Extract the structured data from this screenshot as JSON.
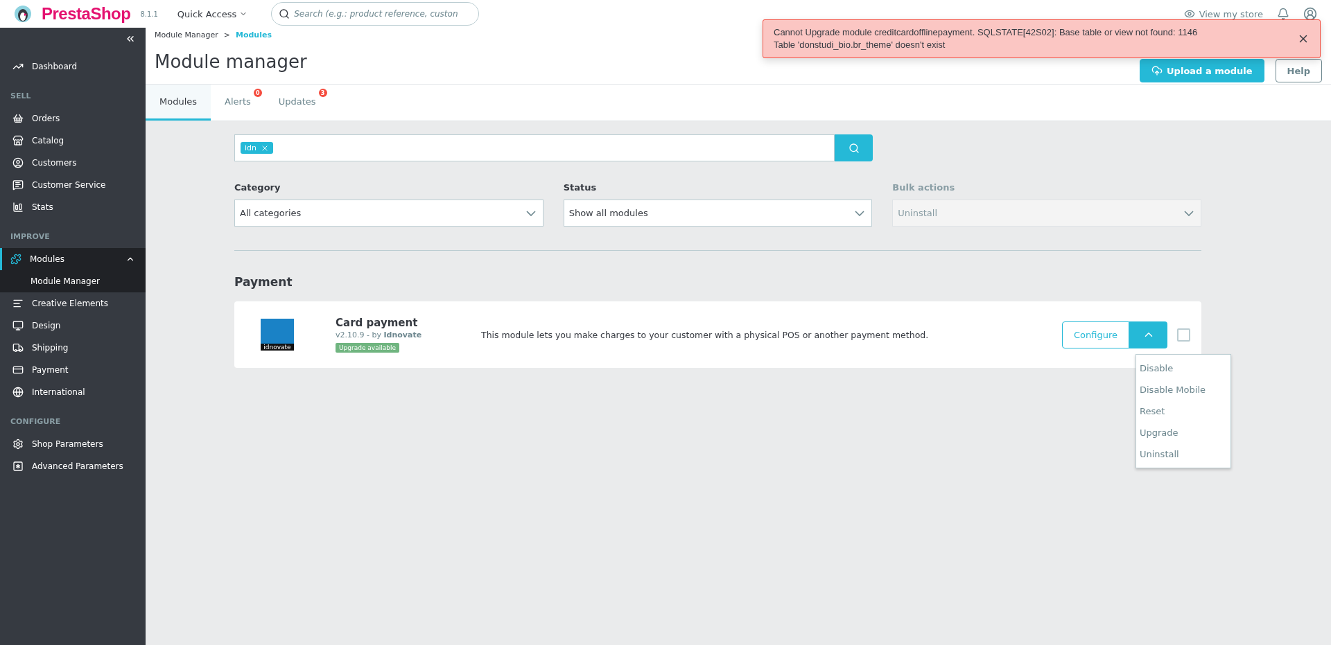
{
  "header": {
    "logo": "PrestaShop",
    "version": "8.1.1",
    "quick_access": "Quick Access",
    "search": {
      "placeholder": "Search (e.g.: product reference, custon"
    },
    "view_store": "View my store"
  },
  "sidebar": {
    "sections": [
      {
        "items": [
          {
            "label": "Dashboard",
            "selected": false
          }
        ]
      },
      {
        "heading": "SELL",
        "items": [
          {
            "label": "Orders",
            "selected": false
          },
          {
            "label": "Catalog",
            "selected": false
          },
          {
            "label": "Customers",
            "selected": false
          },
          {
            "label": "Customer Service",
            "selected": false
          },
          {
            "label": "Stats",
            "selected": false
          }
        ]
      },
      {
        "heading": "IMPROVE",
        "items": [
          {
            "label": "Modules",
            "selected": true,
            "expanded": true,
            "children": [
              {
                "label": "Module Manager",
                "selected": true
              }
            ]
          },
          {
            "label": "Creative Elements",
            "selected": false
          },
          {
            "label": "Design",
            "selected": false
          },
          {
            "label": "Shipping",
            "selected": false
          },
          {
            "label": "Payment",
            "selected": false
          },
          {
            "label": "International",
            "selected": false
          }
        ]
      },
      {
        "heading": "CONFIGURE",
        "items": [
          {
            "label": "Shop Parameters",
            "selected": false
          },
          {
            "label": "Advanced Parameters",
            "selected": false
          }
        ]
      }
    ]
  },
  "breadcrumb": [
    {
      "label": "Module Manager",
      "selected": false
    },
    {
      "label": "Modules",
      "selected": true
    }
  ],
  "breadcrumb_separator": ">",
  "title": "Module manager",
  "page_buttons": [
    {
      "label": "Upload a module",
      "kind": "primary"
    },
    {
      "label": "Help",
      "kind": "outline"
    }
  ],
  "tabs": [
    {
      "label": "Modules",
      "selected": true
    },
    {
      "label": "Alerts",
      "selected": false,
      "badge": "0"
    },
    {
      "label": "Updates",
      "selected": false,
      "badge": "3"
    }
  ],
  "search": {
    "tags": [
      {
        "label": "idn"
      }
    ]
  },
  "filters": [
    {
      "label": "Category",
      "value": "All categories",
      "disabled": false
    },
    {
      "label": "Status",
      "value": "Show all modules",
      "disabled": false
    },
    {
      "label": "Bulk actions",
      "value": "Uninstall",
      "disabled": true
    }
  ],
  "section_heading": "Payment",
  "modules": [
    {
      "name": "Card payment",
      "logo_text": "idnovate",
      "version": "v2.10.9 - by",
      "author": "Idnovate",
      "badge": "Upgrade available",
      "description": "This module lets you make charges to your customer with a physical POS or another payment method.",
      "action": "Configure",
      "checked": false,
      "menu_open": true,
      "menu": [
        "Disable",
        "Disable Mobile",
        "Reset",
        "Upgrade",
        "Uninstall"
      ]
    }
  ],
  "alert": {
    "message": "Cannot Upgrade module creditcardofflinepayment. SQLSTATE[42S02]: Base table or view not found: 1146\nTable 'donstudi_bio.br_theme' doesn't exist"
  }
}
